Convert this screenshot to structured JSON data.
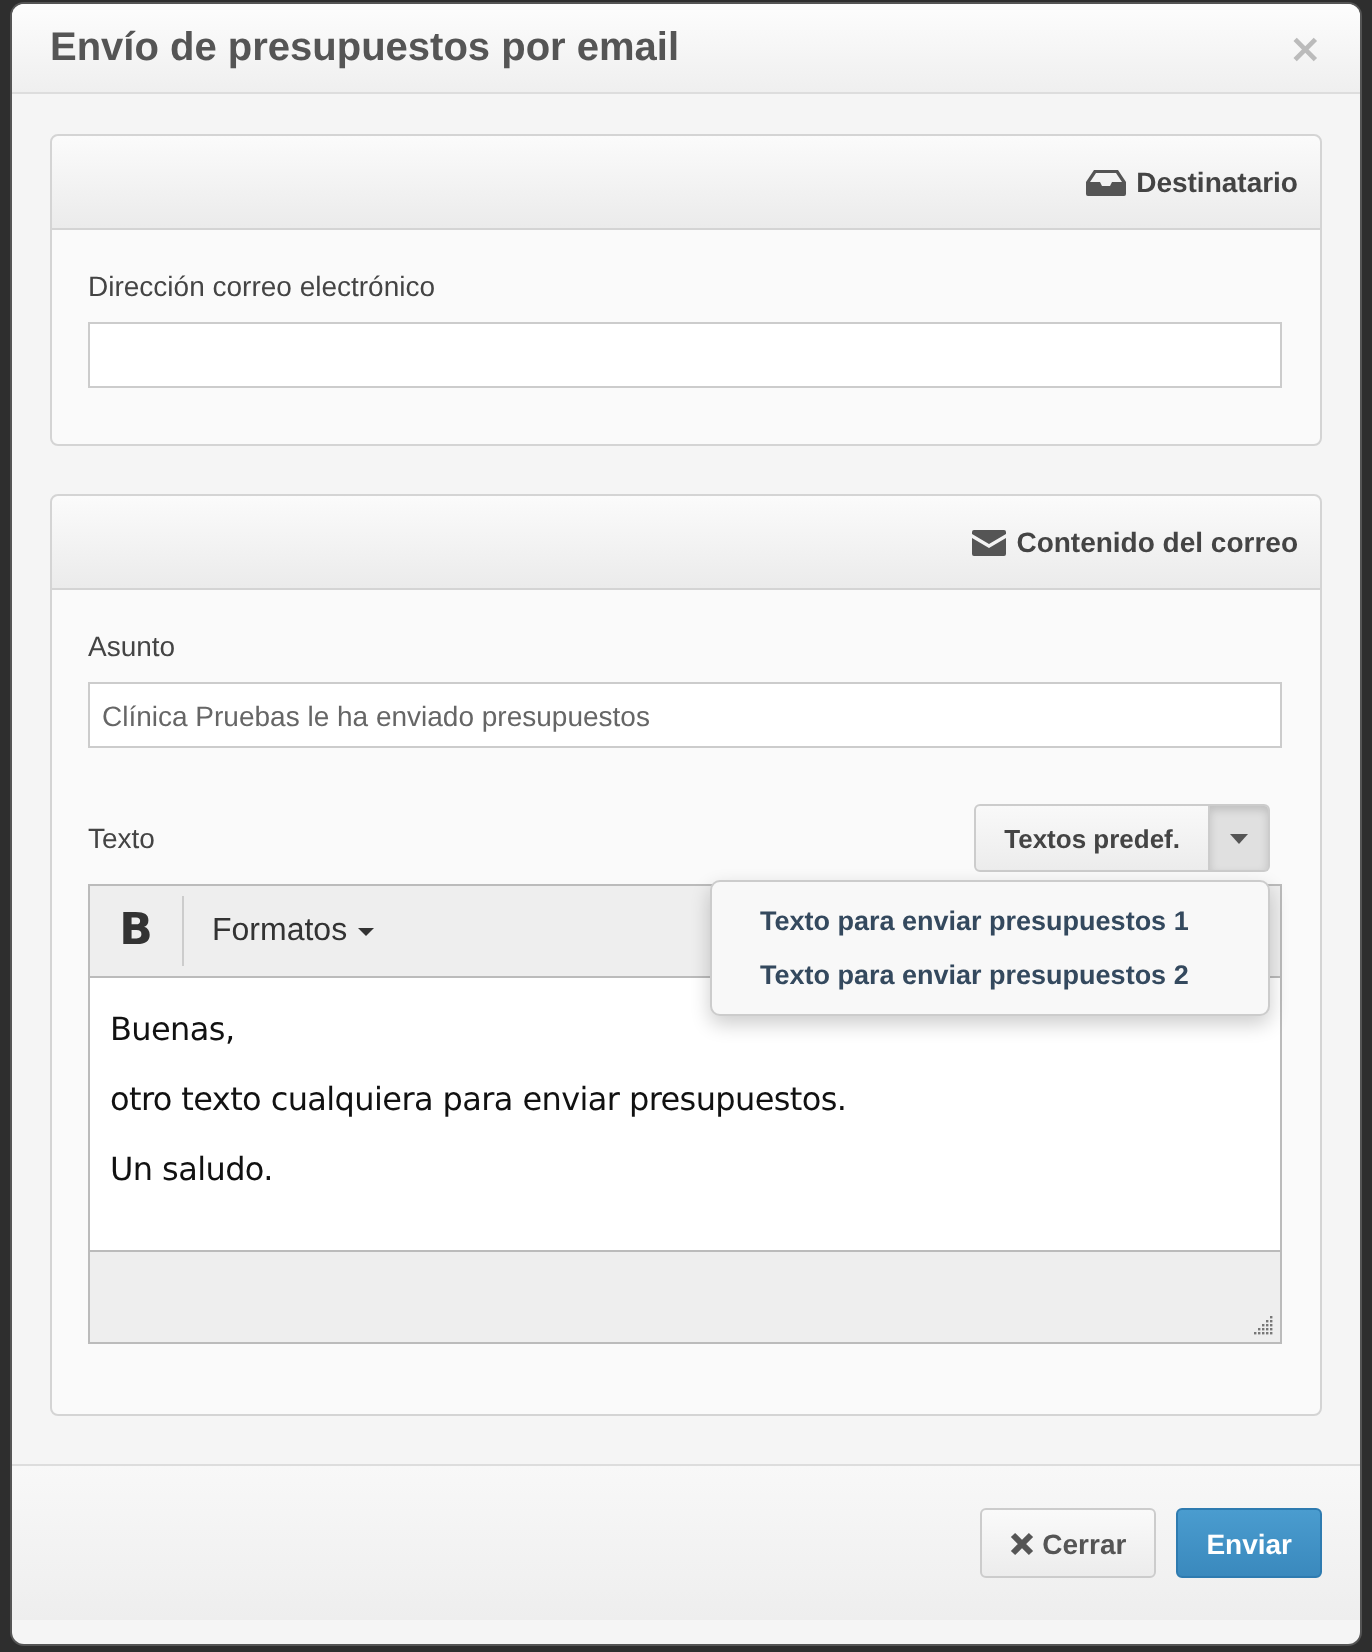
{
  "dialog": {
    "title": "Envío de presupuestos por email",
    "close": "×"
  },
  "panels": [
    {
      "kind": "recipient",
      "title": "Destinatario",
      "fields": [
        {
          "label": "Dirección correo electrónico"
        }
      ]
    },
    {
      "kind": "content",
      "title": "Contenido del correo",
      "fields": [
        {
          "label": "Asunto",
          "value": "Clínica Pruebas le ha enviado presupuestos"
        }
      ],
      "editor": {
        "label": "Texto",
        "predefined": {
          "label": "Textos predef.",
          "expanded": true,
          "items": [
            "Texto para enviar presupuestos 1",
            "Texto para enviar presupuestos 2"
          ]
        },
        "toolbar": {
          "bold": "B",
          "formats": "Formatos"
        },
        "paragraphs": [
          "Buenas,",
          "otro texto cualquiera para enviar presupuestos.",
          "Un saludo."
        ]
      }
    }
  ],
  "footer": {
    "buttons": [
      {
        "kind": "default",
        "label": "Cerrar"
      },
      {
        "kind": "primary",
        "label": "Enviar"
      }
    ]
  }
}
